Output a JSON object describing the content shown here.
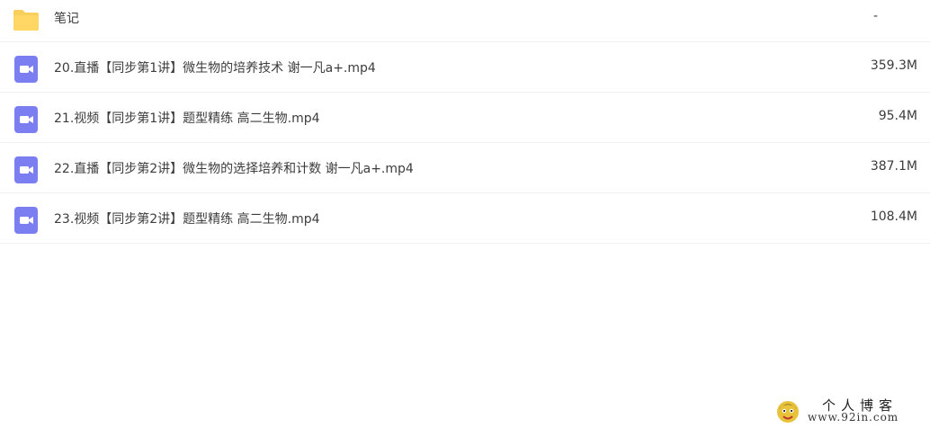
{
  "files": [
    {
      "name": "笔记",
      "size": "-",
      "icon": "folder-icon"
    },
    {
      "name": "20.直播【同步第1讲】微生物的培养技术 谢一凡a+.mp4",
      "size": "359.3M",
      "icon": "video-file-icon"
    },
    {
      "name": "21.视频【同步第1讲】题型精练 高二生物.mp4",
      "size": "95.4M",
      "icon": "video-file-icon"
    },
    {
      "name": "22.直播【同步第2讲】微生物的选择培养和计数 谢一凡a+.mp4",
      "size": "387.1M",
      "icon": "video-file-icon"
    },
    {
      "name": "23.视频【同步第2讲】题型精练 高二生物.mp4",
      "size": "108.4M",
      "icon": "video-file-icon"
    }
  ],
  "watermark": {
    "title": "个人博客",
    "url": "www.92in.com"
  },
  "colors": {
    "folder": "#fdd663",
    "video": "#7b7ef0",
    "divider": "#eef0f3"
  }
}
